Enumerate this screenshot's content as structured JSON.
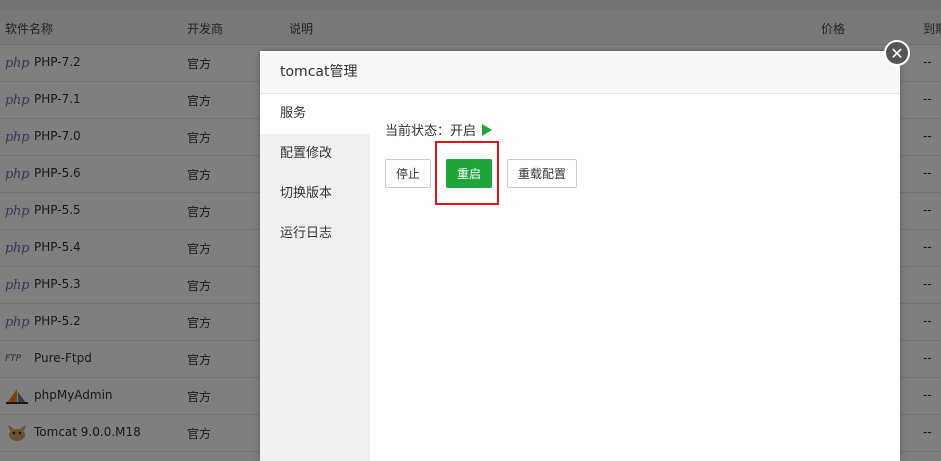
{
  "table": {
    "headers": [
      "软件名称",
      "开发商",
      "说明",
      "价格",
      "到期"
    ],
    "rows": [
      {
        "icon": "php-icon",
        "icon_text": "php",
        "name": "PHP-7.2",
        "dev": "官方",
        "expire": "--"
      },
      {
        "icon": "php-icon",
        "icon_text": "php",
        "name": "PHP-7.1",
        "dev": "官方",
        "expire": "--"
      },
      {
        "icon": "php-icon",
        "icon_text": "php",
        "name": "PHP-7.0",
        "dev": "官方",
        "expire": "--"
      },
      {
        "icon": "php-icon",
        "icon_text": "php",
        "name": "PHP-5.6",
        "dev": "官方",
        "expire": "--"
      },
      {
        "icon": "php-icon",
        "icon_text": "php",
        "name": "PHP-5.5",
        "dev": "官方",
        "expire": "--"
      },
      {
        "icon": "php-icon",
        "icon_text": "php",
        "name": "PHP-5.4",
        "dev": "官方",
        "expire": "--"
      },
      {
        "icon": "php-icon",
        "icon_text": "php",
        "name": "PHP-5.3",
        "dev": "官方",
        "expire": "--"
      },
      {
        "icon": "php-icon",
        "icon_text": "php",
        "name": "PHP-5.2",
        "dev": "官方",
        "expire": "--"
      },
      {
        "icon": "ftp-icon",
        "icon_text": "FTP",
        "name": "Pure-Ftpd",
        "dev": "官方",
        "expire": "--"
      },
      {
        "icon": "phpmyadmin-icon",
        "icon_text": "",
        "name": "phpMyAdmin",
        "dev": "官方",
        "expire": "--"
      },
      {
        "icon": "tomcat-icon",
        "icon_text": "",
        "name": "Tomcat 9.0.0.M18",
        "dev": "官方",
        "expire": "--"
      }
    ]
  },
  "modal": {
    "title": "tomcat管理",
    "menu": [
      "服务",
      "配置修改",
      "切换版本",
      "运行日志"
    ],
    "active_index": 0,
    "status_label": "当前状态：开启",
    "buttons": {
      "stop": "停止",
      "restart": "重启",
      "reload": "重载配置"
    },
    "close_glyph": "✕"
  },
  "colors": {
    "accent": "#20a53a",
    "highlight": "#e0141b"
  }
}
